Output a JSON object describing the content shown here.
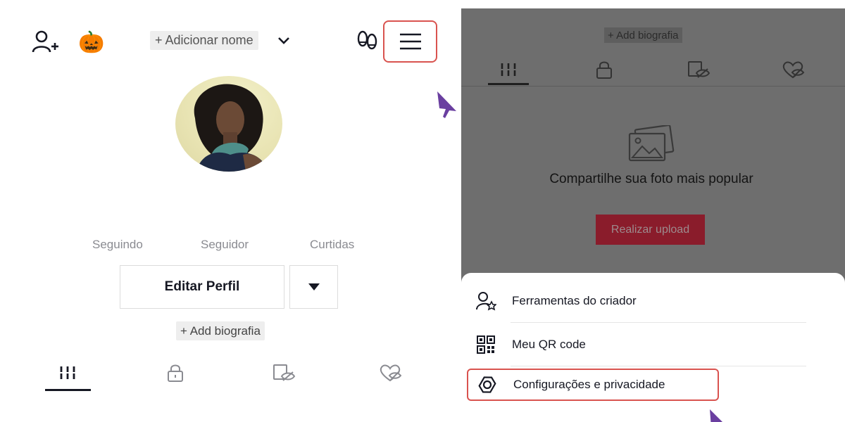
{
  "left": {
    "header": {
      "add_name_label": "+ Adicionar nome",
      "pumpkin_emoji": "🎃",
      "icons": [
        "add-user-icon",
        "pumpkin-icon",
        "chevron-down-icon",
        "footprints-icon",
        "hamburger-menu-icon"
      ]
    },
    "stats": {
      "following_label": "Seguindo",
      "followers_label": "Seguidor",
      "likes_label": "Curtidas"
    },
    "edit_profile_label": "Editar Perfil",
    "add_bio_label": "+ Add biografia",
    "tabs": [
      "videos-grid",
      "private-lock",
      "reposts-eye",
      "liked-heart"
    ]
  },
  "right": {
    "add_bio_label": "+ Add biografia",
    "empty_state_text": "Compartilhe sua foto mais popular",
    "upload_button_label": "Realizar upload",
    "menu": {
      "items": [
        {
          "label": "Ferramentas do criador",
          "icon": "creator-tools-icon"
        },
        {
          "label": "Meu QR code",
          "icon": "qr-code-icon"
        },
        {
          "label": "Configurações e privacidade",
          "icon": "settings-gear-icon"
        }
      ]
    }
  },
  "colors": {
    "highlight_border": "#d9534f",
    "cursor": "#6a3fa0",
    "overlay": "#6e6e6e",
    "upload_button": "#8a1c2b"
  }
}
